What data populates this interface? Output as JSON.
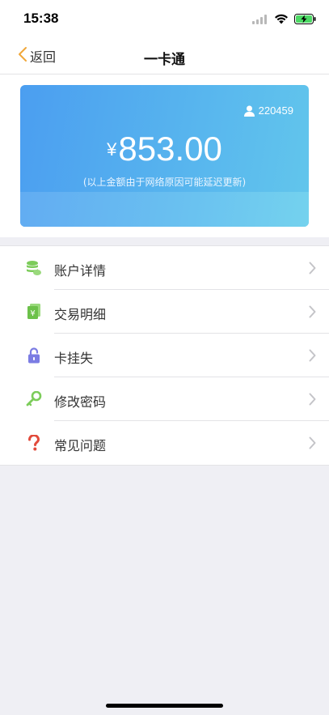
{
  "status_bar": {
    "time": "15:38"
  },
  "nav": {
    "back_label": "返回",
    "title": "一卡通"
  },
  "card": {
    "user_id": "220459",
    "currency_symbol": "¥",
    "balance": "853.00",
    "note": "(以上金额由于网络原因可能延迟更新)"
  },
  "menu": {
    "items": [
      {
        "label": "账户详情",
        "icon": "coins-icon"
      },
      {
        "label": "交易明细",
        "icon": "yen-bill-icon"
      },
      {
        "label": "卡挂失",
        "icon": "lock-icon"
      },
      {
        "label": "修改密码",
        "icon": "key-icon"
      },
      {
        "label": "常见问题",
        "icon": "question-icon"
      }
    ]
  },
  "colors": {
    "card_gradient_start": "#4b9ef0",
    "card_gradient_end": "#62c6ec",
    "icon_green": "#7ccc5a",
    "icon_purple": "#7b7ce3",
    "icon_red": "#e24b3c",
    "back_chevron": "#f0a73a"
  }
}
